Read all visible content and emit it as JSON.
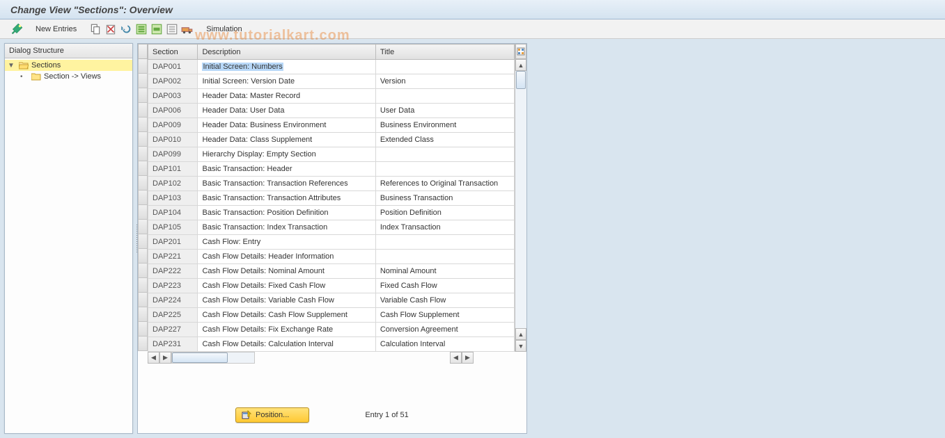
{
  "title": "Change View \"Sections\": Overview",
  "watermark": "www.tutorialkart.com",
  "toolbar": {
    "new_entries": "New Entries",
    "simulation": "Simulation"
  },
  "dialog_structure": {
    "header": "Dialog Structure",
    "root": "Sections",
    "child": "Section -> Views"
  },
  "table": {
    "columns": {
      "section": "Section",
      "description": "Description",
      "title": "Title"
    },
    "rows": [
      {
        "section": "DAP001",
        "description": "Initial Screen: Numbers",
        "title": "",
        "highlighted": true
      },
      {
        "section": "DAP002",
        "description": "Initial Screen: Version Date",
        "title": "Version"
      },
      {
        "section": "DAP003",
        "description": "Header Data: Master Record",
        "title": ""
      },
      {
        "section": "DAP006",
        "description": "Header Data: User Data",
        "title": "User Data"
      },
      {
        "section": "DAP009",
        "description": "Header Data: Business Environment",
        "title": "Business Environment"
      },
      {
        "section": "DAP010",
        "description": "Header Data: Class Supplement",
        "title": "Extended Class"
      },
      {
        "section": "DAP099",
        "description": "Hierarchy Display: Empty Section",
        "title": ""
      },
      {
        "section": "DAP101",
        "description": "Basic Transaction: Header",
        "title": ""
      },
      {
        "section": "DAP102",
        "description": "Basic Transaction: Transaction References",
        "title": "References to Original Transaction"
      },
      {
        "section": "DAP103",
        "description": "Basic Transaction: Transaction Attributes",
        "title": "Business Transaction"
      },
      {
        "section": "DAP104",
        "description": "Basic Transaction: Position Definition",
        "title": "Position Definition"
      },
      {
        "section": "DAP105",
        "description": "Basic Transaction: Index Transaction",
        "title": "Index Transaction"
      },
      {
        "section": "DAP201",
        "description": "Cash Flow: Entry",
        "title": ""
      },
      {
        "section": "DAP221",
        "description": "Cash Flow Details: Header Information",
        "title": ""
      },
      {
        "section": "DAP222",
        "description": "Cash Flow Details: Nominal Amount",
        "title": "Nominal Amount"
      },
      {
        "section": "DAP223",
        "description": "Cash Flow Details: Fixed Cash Flow",
        "title": "Fixed Cash Flow"
      },
      {
        "section": "DAP224",
        "description": "Cash Flow Details: Variable Cash Flow",
        "title": "Variable Cash Flow"
      },
      {
        "section": "DAP225",
        "description": "Cash Flow Details: Cash Flow Supplement",
        "title": "Cash Flow Supplement"
      },
      {
        "section": "DAP227",
        "description": "Cash Flow Details: Fix Exchange Rate",
        "title": "Conversion Agreement"
      },
      {
        "section": "DAP231",
        "description": "Cash Flow Details: Calculation Interval",
        "title": "Calculation Interval"
      }
    ]
  },
  "footer": {
    "position_label": "Position...",
    "entry_text": "Entry 1 of 51"
  }
}
